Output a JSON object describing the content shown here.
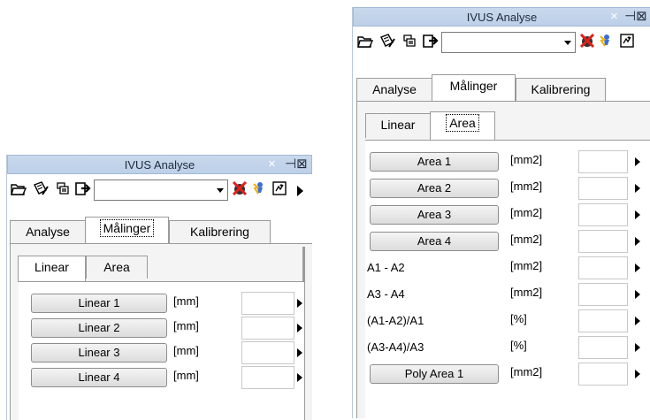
{
  "colors": {
    "title_bar": "#bcd0e8",
    "title_text": "#1f2a3a",
    "button_face": "#e6e6e6",
    "tab_page": "#f4f4f4"
  },
  "panels": {
    "left": {
      "title": "IVUS Analyse",
      "close_glyph": "×",
      "pin_glyph": "⊣⊠",
      "toolbar": {
        "icons": [
          "open-folder-icon",
          "edit-document-icon",
          "layers-icon",
          "export-icon",
          "stop-measure-icon",
          "lightning-person-icon",
          "calculator-icon"
        ],
        "combo_value": ""
      },
      "tabs": [
        "Analyse",
        "Målinger",
        "Kalibrering"
      ],
      "active_tab": "Målinger",
      "sub_tabs": [
        "Linear",
        "Area"
      ],
      "active_sub_tab": "Linear",
      "rows": [
        {
          "button": "Linear 1",
          "unit": "[mm]",
          "value": ""
        },
        {
          "button": "Linear 2",
          "unit": "[mm]",
          "value": ""
        },
        {
          "button": "Linear 3",
          "unit": "[mm]",
          "value": ""
        },
        {
          "button": "Linear 4",
          "unit": "[mm]",
          "value": ""
        }
      ]
    },
    "right": {
      "title": "IVUS Analyse",
      "close_glyph": "×",
      "pin_glyph": "⊣⊠",
      "toolbar": {
        "icons": [
          "open-folder-icon",
          "edit-document-icon",
          "layers-icon",
          "export-icon",
          "stop-measure-icon",
          "lightning-person-icon",
          "calculator-icon"
        ],
        "combo_value": ""
      },
      "tabs": [
        "Analyse",
        "Målinger",
        "Kalibrering"
      ],
      "active_tab": "Målinger",
      "sub_tabs": [
        "Linear",
        "Area"
      ],
      "active_sub_tab": "Area",
      "rows": [
        {
          "button": "Area 1",
          "unit": "[mm2]",
          "value": ""
        },
        {
          "button": "Area 2",
          "unit": "[mm2]",
          "value": ""
        },
        {
          "button": "Area 3",
          "unit": "[mm2]",
          "value": ""
        },
        {
          "button": "Area 4",
          "unit": "[mm2]",
          "value": ""
        },
        {
          "label": "A1 - A2",
          "unit": "[mm2]",
          "value": ""
        },
        {
          "label": "A3 - A4",
          "unit": "[mm2]",
          "value": ""
        },
        {
          "label": "(A1-A2)/A1",
          "unit": "[%]",
          "value": ""
        },
        {
          "label": "(A3-A4)/A3",
          "unit": "[%]",
          "value": ""
        },
        {
          "button": "Poly Area 1",
          "unit": "[mm2]",
          "value": ""
        }
      ]
    }
  }
}
